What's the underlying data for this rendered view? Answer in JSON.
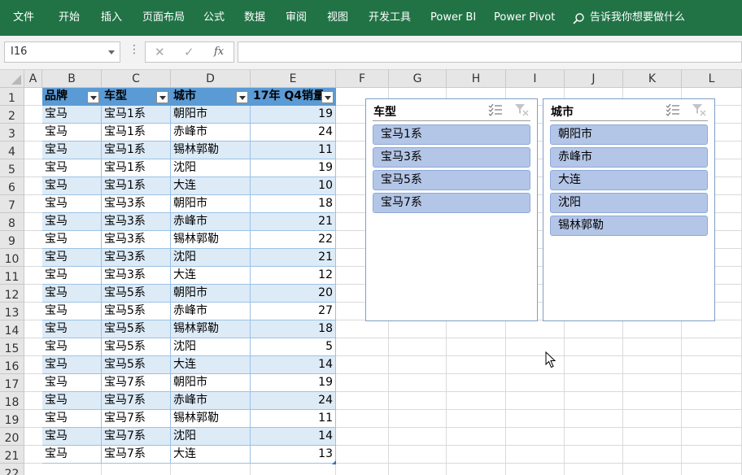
{
  "ribbon": {
    "tabs": [
      "文件",
      "开始",
      "插入",
      "页面布局",
      "公式",
      "数据",
      "审阅",
      "视图",
      "开发工具",
      "Power BI",
      "Power Pivot"
    ],
    "tell_me": "告诉我你想要做什么",
    "color": "#217346"
  },
  "formula_bar": {
    "name_box": "I16",
    "cancel_icon": "✕",
    "enter_icon": "✓",
    "fx_label": "fx",
    "formula": ""
  },
  "sheet": {
    "columns": [
      "A",
      "B",
      "C",
      "D",
      "E",
      "F",
      "G",
      "H",
      "I",
      "J",
      "K",
      "L"
    ],
    "rows": [
      "1",
      "2",
      "3",
      "4",
      "5",
      "6",
      "7",
      "8",
      "9",
      "10",
      "11",
      "12",
      "13",
      "14",
      "15",
      "16",
      "17",
      "18",
      "19",
      "20",
      "21",
      "22"
    ]
  },
  "table": {
    "headers": [
      "品牌",
      "车型",
      "城市",
      "17年 Q4销量"
    ],
    "header_color": "#5b9bd5",
    "band_color": "#ddebf7",
    "rows": [
      [
        "宝马",
        "宝马1系",
        "朝阳市",
        "19"
      ],
      [
        "宝马",
        "宝马1系",
        "赤峰市",
        "24"
      ],
      [
        "宝马",
        "宝马1系",
        "锡林郭勒",
        "11"
      ],
      [
        "宝马",
        "宝马1系",
        "沈阳",
        "19"
      ],
      [
        "宝马",
        "宝马1系",
        "大连",
        "10"
      ],
      [
        "宝马",
        "宝马3系",
        "朝阳市",
        "18"
      ],
      [
        "宝马",
        "宝马3系",
        "赤峰市",
        "21"
      ],
      [
        "宝马",
        "宝马3系",
        "锡林郭勒",
        "22"
      ],
      [
        "宝马",
        "宝马3系",
        "沈阳",
        "21"
      ],
      [
        "宝马",
        "宝马3系",
        "大连",
        "12"
      ],
      [
        "宝马",
        "宝马5系",
        "朝阳市",
        "20"
      ],
      [
        "宝马",
        "宝马5系",
        "赤峰市",
        "27"
      ],
      [
        "宝马",
        "宝马5系",
        "锡林郭勒",
        "18"
      ],
      [
        "宝马",
        "宝马5系",
        "沈阳",
        "5"
      ],
      [
        "宝马",
        "宝马5系",
        "大连",
        "14"
      ],
      [
        "宝马",
        "宝马7系",
        "朝阳市",
        "19"
      ],
      [
        "宝马",
        "宝马7系",
        "赤峰市",
        "24"
      ],
      [
        "宝马",
        "宝马7系",
        "锡林郭勒",
        "11"
      ],
      [
        "宝马",
        "宝马7系",
        "沈阳",
        "14"
      ],
      [
        "宝马",
        "宝马7系",
        "大连",
        "13"
      ]
    ]
  },
  "slicers": [
    {
      "title": "车型",
      "items": [
        "宝马1系",
        "宝马3系",
        "宝马5系",
        "宝马7系"
      ]
    },
    {
      "title": "城市",
      "items": [
        "朝阳市",
        "赤峰市",
        "大连",
        "沈阳",
        "锡林郭勒"
      ]
    }
  ],
  "slicer_style": {
    "item_color": "#b4c6e7",
    "border_color": "#7f9fc8"
  }
}
